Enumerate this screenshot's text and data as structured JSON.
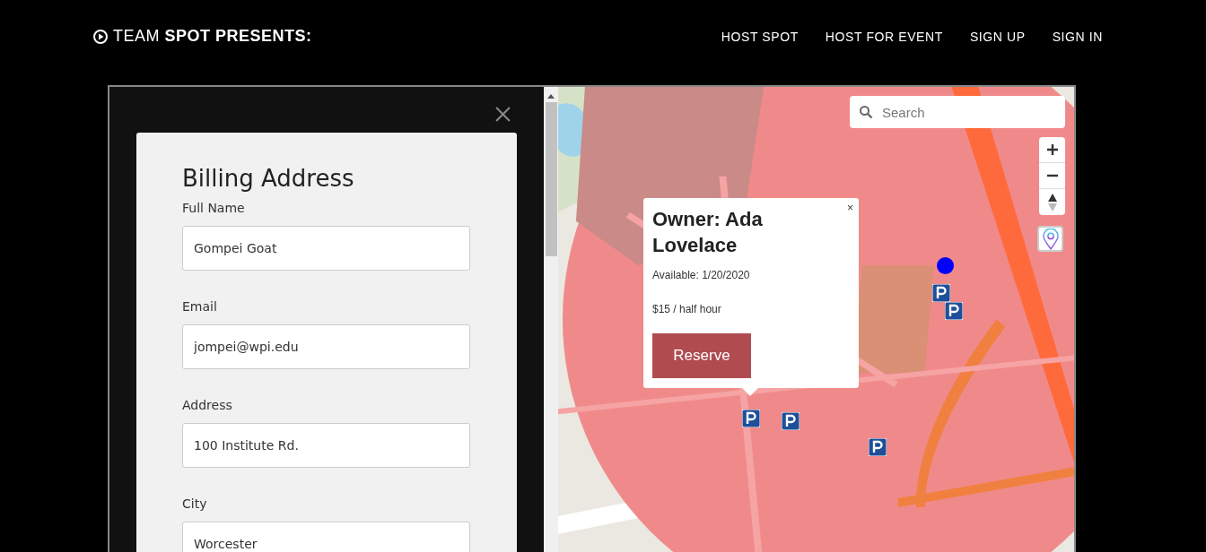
{
  "header": {
    "logo": "TEAM **SPOT PRESENTS:**",
    "nav": [
      "HOST SPOT",
      "HOST FOR EVENT",
      "SIGN UP",
      "SIGN IN"
    ]
  },
  "billing": {
    "title": "Billing Address",
    "fields": [
      {
        "label": "Full Name",
        "value": "Gompei Goat"
      },
      {
        "label": "Email",
        "value": "jompei@wpi.edu"
      },
      {
        "label": "Address",
        "value": "100 Institute Rd."
      },
      {
        "label": "City",
        "value": "Worcester"
      }
    ]
  },
  "map": {
    "search": {
      "placeholder": "Search"
    },
    "popup": {
      "close": "×",
      "title": "Owner: Ada Lovelace",
      "available": "Available: 1/20/2020",
      "price": "$15 / half hour",
      "button": "Reserve"
    }
  }
}
